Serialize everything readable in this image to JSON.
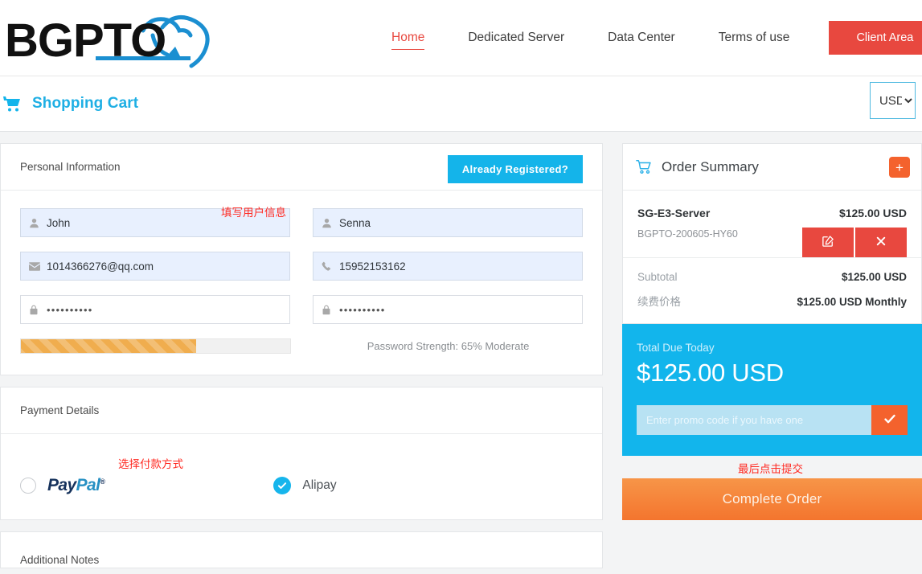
{
  "header": {
    "logo_text": "BGPTO",
    "nav": [
      {
        "label": "Home",
        "active": true
      },
      {
        "label": "Dedicated Server",
        "active": false
      },
      {
        "label": "Data Center",
        "active": false
      },
      {
        "label": "Terms of use",
        "active": false
      }
    ],
    "client_area_label": "Client Area"
  },
  "cart_bar": {
    "title": "Shopping Cart",
    "cart_icon": "shopping-cart-icon",
    "currency_selected": "USD",
    "currency_options": [
      "USD"
    ]
  },
  "personal_information": {
    "title": "Personal Information",
    "already_registered_label": "Already Registered?",
    "annotation": "填写用户信息",
    "fields": {
      "first_name": {
        "value": "John",
        "icon": "user-icon"
      },
      "last_name": {
        "value": "Senna",
        "icon": "user-icon"
      },
      "email": {
        "value": "1014366276@qq.com",
        "icon": "envelope-icon"
      },
      "phone": {
        "value": "15952153162",
        "icon": "phone-icon"
      },
      "password": {
        "value": "••••••••••",
        "icon": "lock-icon"
      },
      "confirm_password": {
        "value": "••••••••••",
        "icon": "lock-icon"
      }
    },
    "password_strength": {
      "label": "Password Strength: 65% Moderate",
      "percent": 65,
      "color": "#f0ad4e"
    }
  },
  "payment_details": {
    "title": "Payment Details",
    "annotation": "选择付款方式",
    "options": [
      {
        "label": "PayPal",
        "selected": false,
        "icon": "paypal-logo"
      },
      {
        "label": "Alipay",
        "selected": true,
        "icon": "check-circle-icon"
      }
    ]
  },
  "additional_notes": {
    "title": "Additional Notes"
  },
  "order_summary": {
    "title": "Order Summary",
    "cart_icon": "shopping-cart-outline-icon",
    "add_button_icon": "plus-icon",
    "item": {
      "name": "SG-E3-Server",
      "price": "$125.00 USD",
      "reference": "BGPTO-200605-HY60",
      "edit_icon": "edit-square-icon",
      "remove_icon": "times-icon"
    },
    "totals": [
      {
        "label": "Subtotal",
        "value": "$125.00 USD"
      },
      {
        "label": "续费价格",
        "value": "$125.00 USD Monthly"
      }
    ],
    "total_due": {
      "label": "Total Due Today",
      "amount": "$125.00 USD"
    },
    "promo": {
      "placeholder": "Enter promo code if you have one",
      "submit_icon": "check-icon"
    },
    "complete_order_label": "Complete Order",
    "complete_order_annotation": "最后点击提交"
  },
  "colors": {
    "brand_blue": "#12b5ec",
    "accent_red": "#e8483f",
    "accent_orange": "#f4622d",
    "strength_orange": "#f0ad4e",
    "annotation_red": "#ff2a22"
  }
}
